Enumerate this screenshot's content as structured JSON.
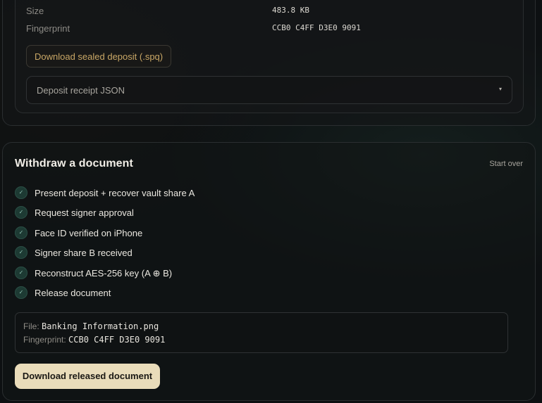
{
  "deposit": {
    "size_label": "Size",
    "size_value": "483.8 KB",
    "fingerprint_label": "Fingerprint",
    "fingerprint_value": "CCB0 C4FF D3E0 9091",
    "download_sealed_label": "Download sealed deposit (.spq)",
    "receipt_select_value": "Deposit receipt JSON",
    "receipt_caret": "▾"
  },
  "withdraw": {
    "title": "Withdraw a document",
    "start_over_label": "Start over",
    "check_glyph": "✓",
    "steps": [
      {
        "label": "Present deposit + recover vault share A",
        "status": "done"
      },
      {
        "label": "Request signer approval",
        "status": "done"
      },
      {
        "label": "Face ID verified on iPhone",
        "status": "done"
      },
      {
        "label": "Signer share B received",
        "status": "done"
      },
      {
        "label": "Reconstruct AES-256 key (A ⊕ B)",
        "status": "done"
      },
      {
        "label": "Release document",
        "status": "done"
      }
    ],
    "file_label": "File:",
    "file_value": "Banking Information.png",
    "fingerprint_label": "Fingerprint:",
    "fingerprint_value": "CCB0 C4FF D3E0 9091",
    "download_released_label": "Download released document"
  },
  "colors": {
    "accent_gold": "#c9a766",
    "button_cream": "#e9dcba",
    "step_done": "#1d3a33"
  }
}
